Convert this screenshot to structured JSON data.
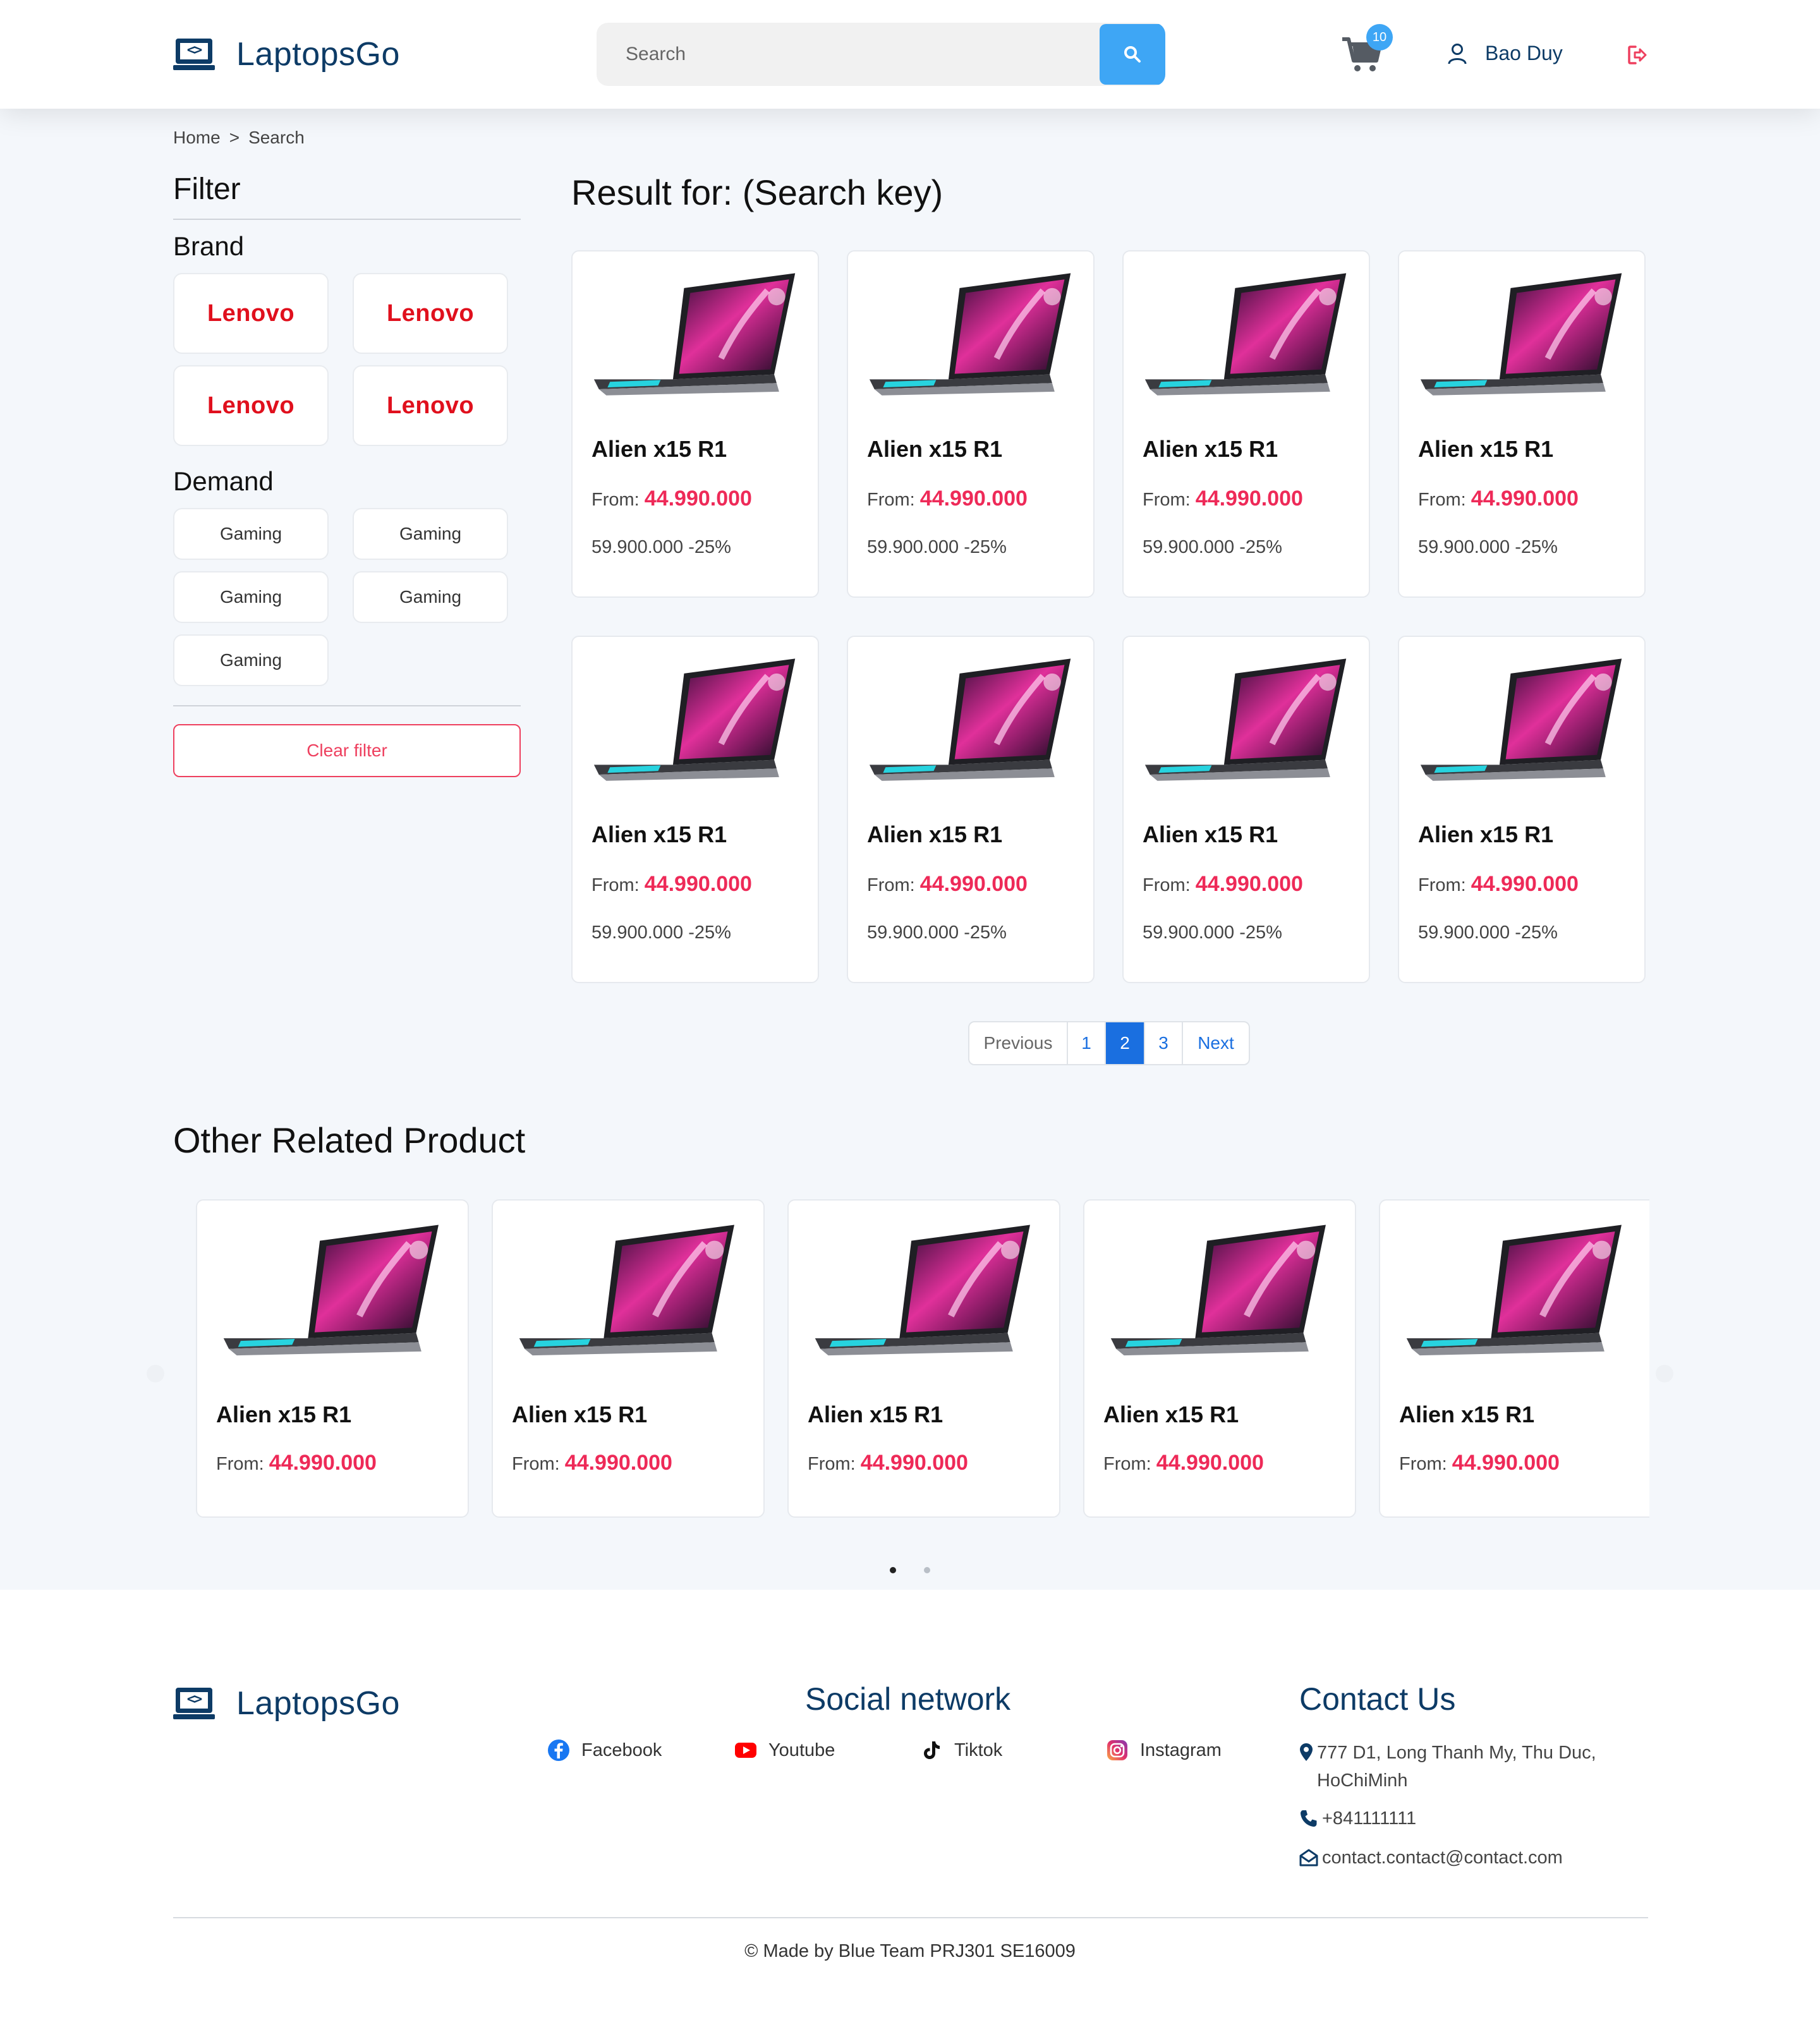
{
  "brand": {
    "name": "LaptopsGo"
  },
  "header": {
    "search_placeholder": "Search",
    "cart_count": "10",
    "user_name": "Bao Duy"
  },
  "breadcrumb": {
    "home": "Home",
    "separator": ">",
    "current": "Search"
  },
  "filter": {
    "title": "Filter",
    "brand_title": "Brand",
    "brands": [
      "Lenovo",
      "Lenovo",
      "Lenovo",
      "Lenovo"
    ],
    "demand_title": "Demand",
    "demands": [
      "Gaming",
      "Gaming",
      "Gaming",
      "Gaming",
      "Gaming"
    ],
    "clear_label": "Clear filter"
  },
  "results": {
    "title": "Result for: (Search key)",
    "products": [
      {
        "name": "Alien x15 R1",
        "from_label": "From:",
        "price": "44.990.000",
        "old": "59.900.000 -25%"
      },
      {
        "name": "Alien x15 R1",
        "from_label": "From:",
        "price": "44.990.000",
        "old": "59.900.000 -25%"
      },
      {
        "name": "Alien x15 R1",
        "from_label": "From:",
        "price": "44.990.000",
        "old": "59.900.000 -25%"
      },
      {
        "name": "Alien x15 R1",
        "from_label": "From:",
        "price": "44.990.000",
        "old": "59.900.000 -25%"
      },
      {
        "name": "Alien x15 R1",
        "from_label": "From:",
        "price": "44.990.000",
        "old": "59.900.000 -25%"
      },
      {
        "name": "Alien x15 R1",
        "from_label": "From:",
        "price": "44.990.000",
        "old": "59.900.000 -25%"
      },
      {
        "name": "Alien x15 R1",
        "from_label": "From:",
        "price": "44.990.000",
        "old": "59.900.000 -25%"
      },
      {
        "name": "Alien x15 R1",
        "from_label": "From:",
        "price": "44.990.000",
        "old": "59.900.000 -25%"
      }
    ]
  },
  "pagination": {
    "previous": "Previous",
    "pages": [
      "1",
      "2",
      "3"
    ],
    "current": "2",
    "next": "Next"
  },
  "related": {
    "title": "Other Related Product",
    "products": [
      {
        "name": "Alien x15 R1",
        "from_label": "From:",
        "price": "44.990.000"
      },
      {
        "name": "Alien x15 R1",
        "from_label": "From:",
        "price": "44.990.000"
      },
      {
        "name": "Alien x15 R1",
        "from_label": "From:",
        "price": "44.990.000"
      },
      {
        "name": "Alien x15 R1",
        "from_label": "From:",
        "price": "44.990.000"
      },
      {
        "name": "Alien x15 R1",
        "from_label": "From:",
        "price": "44.990.000"
      }
    ]
  },
  "footer": {
    "social_title": "Social network",
    "social": [
      {
        "label": "Facebook",
        "icon": "facebook-icon"
      },
      {
        "label": "Youtube",
        "icon": "youtube-icon"
      },
      {
        "label": "Tiktok",
        "icon": "tiktok-icon"
      },
      {
        "label": "Instagram",
        "icon": "instagram-icon"
      }
    ],
    "contact_title": "Contact Us",
    "address_line1": "777 D1, Long Thanh My, Thu Duc,",
    "address_line2": "HoChiMinh",
    "phone": "+841111111",
    "email": "contact.contact@contact.com",
    "copyright": "© Made by Blue Team PRJ301 SE16009"
  },
  "colors": {
    "brand_navy": "#0d3b66",
    "accent_blue": "#3ea6f5",
    "price_pink": "#ee2a58",
    "lenovo_red": "#e0101d",
    "page_bg": "#f4f7fb"
  }
}
